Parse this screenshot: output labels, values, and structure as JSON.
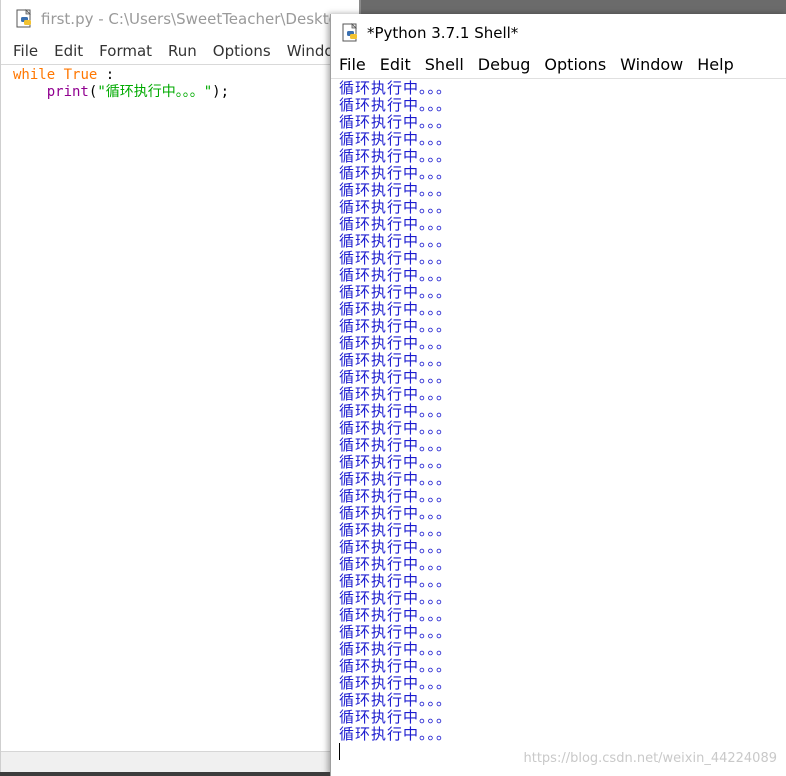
{
  "editor": {
    "title": "first.py - C:\\Users\\SweetTeacher\\Deskto",
    "menu": [
      "File",
      "Edit",
      "Format",
      "Run",
      "Options",
      "Window"
    ],
    "code": {
      "line1_keyword": "while",
      "line1_keyword2": "True",
      "line1_rest": " :",
      "line2_indent": "    ",
      "line2_builtin": "print",
      "line2_open": "(",
      "line2_string": "\"循环执行中。。。\"",
      "line2_close": ");"
    }
  },
  "shell": {
    "title": "*Python 3.7.1 Shell*",
    "menu": [
      "File",
      "Edit",
      "Shell",
      "Debug",
      "Options",
      "Window",
      "Help"
    ],
    "output_line": "循环执行中。。。",
    "output_count": 39
  },
  "watermark": "https://blog.csdn.net/weixin_44224089",
  "colors": {
    "keyword": "#ff7700",
    "builtin": "#900090",
    "string": "#00aa00",
    "shell_output": "#1c1ccf"
  }
}
